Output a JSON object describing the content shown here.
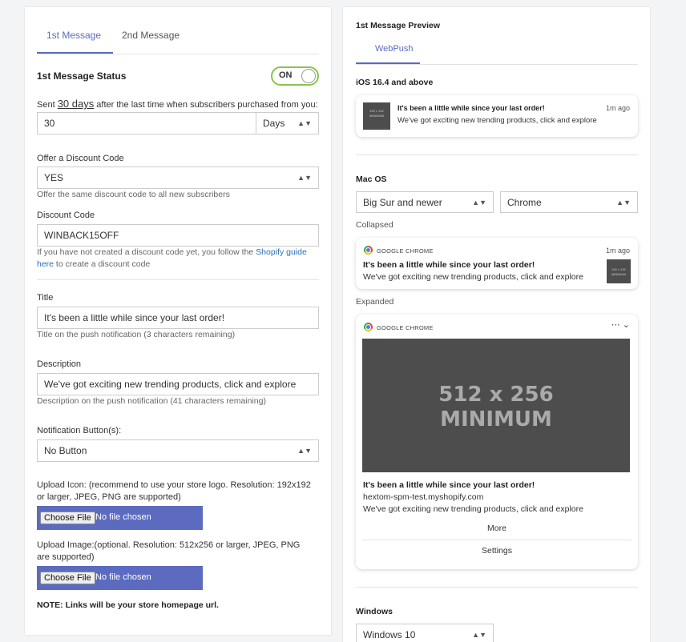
{
  "left": {
    "tabs": [
      "1st Message",
      "2nd Message"
    ],
    "status_label": "1st Message Status",
    "toggle_text": "ON",
    "sent_prefix": "Sent ",
    "sent_days_phrase": "30 days",
    "sent_suffix": " after the last time when subscribers purchased from you:",
    "days_value": "30",
    "days_unit": "Days",
    "offer_label": "Offer a Discount Code",
    "offer_value": "YES",
    "offer_hint": "Offer the same discount code to all new subscribers",
    "code_label": "Discount Code",
    "code_value": "WINBACK15OFF",
    "code_hint_1": "If you have not created a discount code yet, you follow the ",
    "code_hint_link_1": "Shopify guide",
    "code_hint_link_2": "here",
    "code_hint_2": " to create a discount code",
    "title_label": "Title",
    "title_value": "It's been a little while since your last order!",
    "title_hint": "Title on the push notification (3 characters remaining)",
    "desc_label": "Description",
    "desc_value": "We've got exciting new trending products, click and explore",
    "desc_hint": "Description on the push notification (41 characters remaining)",
    "buttons_label": "Notification Button(s):",
    "buttons_value": "No Button",
    "icon_label": "Upload Icon: (recommend to use your store logo. Resolution: 192x192 or larger, JPEG, PNG are supported)",
    "image_label": "Upload Image:(optional. Resolution: 512x256 or larger, JPEG, PNG are supported)",
    "choose_file": "Choose File",
    "no_file": "No file chosen",
    "note": "NOTE: Links will be your store homepage url."
  },
  "right": {
    "preview_title": "1st Message Preview",
    "tab": "WebPush",
    "ios_label": "iOS 16.4 and above",
    "notif_title": "It's been a little while since your last order!",
    "notif_body": "We've got exciting new trending products, click and explore",
    "time": "1m ago",
    "mac_label": "Mac OS",
    "mac_version": "Big Sur and newer",
    "browser": "Chrome",
    "collapsed_label": "Collapsed",
    "chrome_name": "GOOGLE CHROME",
    "expanded_label": "Expanded",
    "image_placeholder_1": "512 x 256",
    "image_placeholder_2": "MINIMUM",
    "domain": "hextom-spm-test.myshopify.com",
    "more": "More",
    "settings": "Settings",
    "windows_label": "Windows",
    "windows_version": "Windows 10",
    "thumb_text": "192 x 192 MINIMUM"
  },
  "colors": {
    "accent": "#5b6bbf",
    "toggle_on": "#8bc34a",
    "file_bar": "#5c6bc0",
    "link": "#2a6ebb"
  }
}
